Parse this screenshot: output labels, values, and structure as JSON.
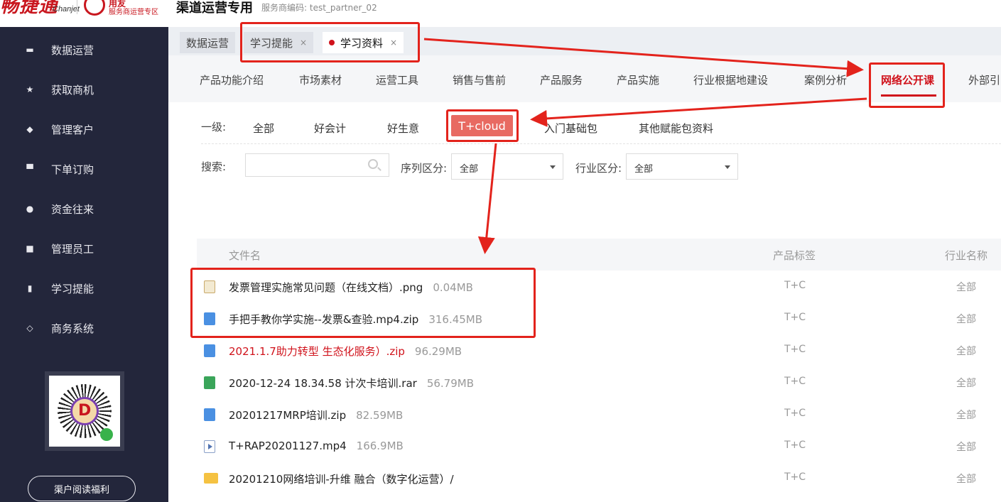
{
  "header": {
    "logo_cn": "畅捷通",
    "logo_en": "Chanjet",
    "yy_name": "用友",
    "yy_sub": "服务商运营专区",
    "title": "渠道运营专用",
    "partner_code": "服务商编码: test_partner_02"
  },
  "sidebar": {
    "items": [
      {
        "label": "数据运营",
        "icon": "chart-icon"
      },
      {
        "label": "获取商机",
        "icon": "star-icon"
      },
      {
        "label": "管理客户",
        "icon": "diamond-icon"
      },
      {
        "label": "下单订购",
        "icon": "cart-icon"
      },
      {
        "label": "资金往来",
        "icon": "money-bag-icon"
      },
      {
        "label": "管理员工",
        "icon": "id-card-icon"
      },
      {
        "label": "学习提能",
        "icon": "book-icon"
      },
      {
        "label": "商务系统",
        "icon": "tag-icon"
      }
    ],
    "welfare_button": "渠户阅读福利"
  },
  "tabs": [
    {
      "label": "数据运营",
      "closable": false
    },
    {
      "label": "学习提能",
      "closable": true,
      "close": "×"
    },
    {
      "label": "学习资料",
      "closable": true,
      "close": "×",
      "active": true
    }
  ],
  "categories": [
    "产品功能介绍",
    "市场素材",
    "运营工具",
    "销售与售前",
    "产品服务",
    "产品实施",
    "行业根据地建设",
    "案例分析",
    "网络公开课",
    "外部引"
  ],
  "active_category": "网络公开课",
  "filters": {
    "level_label": "一级:",
    "levels": [
      "全部",
      "好会计",
      "好生意",
      "T+cloud",
      "入门基础包",
      "其他赋能包资料"
    ],
    "active_level": "T+cloud",
    "search_label": "搜索:",
    "search_value": "",
    "series_label": "序列区分:",
    "series_value": "全部",
    "industry_label": "行业区分:",
    "industry_value": "全部"
  },
  "table": {
    "headers": {
      "name": "文件名",
      "tag": "产品标签",
      "industry": "行业名称"
    },
    "rows": [
      {
        "type": "png",
        "name": "发票管理实施常见问题（在线文档）.png",
        "size": "0.04MB",
        "tag": "T+C",
        "industry": "全部"
      },
      {
        "type": "zip",
        "name": "手把手教你学实施--发票&查验.mp4.zip",
        "size": "316.45MB",
        "tag": "T+C",
        "industry": "全部"
      },
      {
        "type": "zip",
        "name": "2021.1.7助力转型 生态化服务）.zip",
        "size": "96.29MB",
        "tag": "T+C",
        "industry": "全部",
        "highlight": true
      },
      {
        "type": "rar",
        "name": "2020-12-24 18.34.58 计次卡培训.rar",
        "size": "56.79MB",
        "tag": "T+C",
        "industry": "全部"
      },
      {
        "type": "zip",
        "name": "20201217MRP培训.zip",
        "size": "82.59MB",
        "tag": "T+C",
        "industry": "全部"
      },
      {
        "type": "mp4",
        "name": "T+RAP20201127.mp4",
        "size": "166.9MB",
        "tag": "T+C",
        "industry": "全部"
      },
      {
        "type": "folder",
        "name": "20201210网络培训-升维 融合（数字化运营）/",
        "size": "",
        "tag": "T+C",
        "industry": "全部"
      }
    ]
  },
  "colors": {
    "sidebar_bg": "#23263b",
    "accent_red": "#d0121b",
    "annotation_red": "#e3231c",
    "level_btn": "#e86a62"
  }
}
